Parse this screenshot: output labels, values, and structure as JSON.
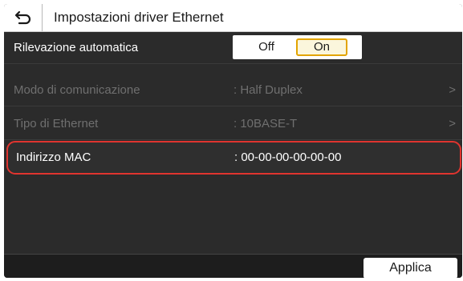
{
  "header": {
    "back_icon": "back-arrow-icon",
    "title": "Impostazioni driver Ethernet"
  },
  "rows": [
    {
      "label": "Rilevazione automatica",
      "toggle": {
        "off_label": "Off",
        "on_label": "On",
        "selected": "On"
      }
    },
    {
      "label": "Modo di comunicazione",
      "value": ": Half Duplex",
      "chevron": ">",
      "state": "disabled"
    },
    {
      "label": "Tipo di Ethernet",
      "value": ": 10BASE-T",
      "chevron": ">",
      "state": "disabled"
    },
    {
      "label": "Indirizzo MAC",
      "value": ":  00-00-00-00-00-00",
      "state": "highlighted"
    }
  ],
  "footer": {
    "apply_label": "Applica"
  },
  "colors": {
    "highlight_border": "#e0342f",
    "selected_toggle_border": "#e2a400",
    "background": "#2b2b2b"
  }
}
